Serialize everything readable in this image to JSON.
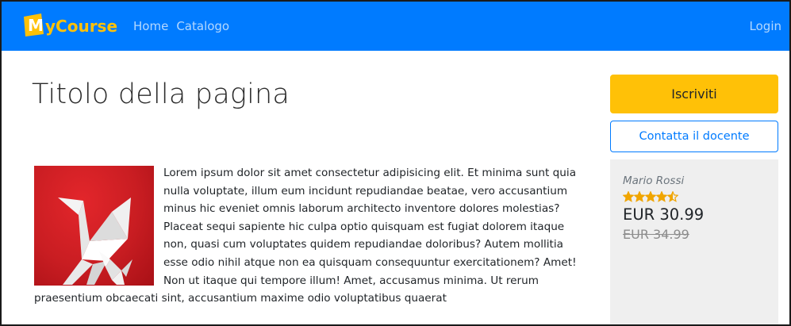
{
  "navbar": {
    "brand": "MyCourse",
    "brand_initial": "M",
    "brand_rest": "yCourse",
    "links": [
      "Home",
      "Catalogo"
    ],
    "login": "Login"
  },
  "main": {
    "title": "Titolo della pagina",
    "description": "Lorem ipsum dolor sit amet consectetur adipisicing elit. Et minima sunt quia nulla voluptate, illum eum incidunt repudiandae beatae, vero accusantium minus hic eveniet omnis laborum architecto inventore dolores molestias? Placeat sequi sapiente hic culpa optio quisquam est fugiat dolorem itaque non, quasi cum voluptates quidem repudiandae doloribus? Autem mollitia esse odio nihil atque non ea quisquam consequuntur exercitationem? Amet! Non ut itaque qui tempore illum! Amet, accusamus minima. Ut rerum praesentium obcaecati sint, accusantium maxime odio voluptatibus quaerat"
  },
  "sidebar": {
    "subscribe_label": "Iscriviti",
    "contact_label": "Contatta il docente",
    "teacher": "Mario Rossi",
    "rating": 4.5,
    "rating_max": 5,
    "current_price": "EUR 30.99",
    "full_price": "EUR 34.99"
  },
  "colors": {
    "navbar": "#007bff",
    "brand": "#ffc107",
    "subscribe_button": "#ffc107",
    "stars": "#f0a500",
    "info_box": "#efefef"
  },
  "icons": {
    "course_image": "origami-bird-image",
    "rating": "star-icon"
  }
}
